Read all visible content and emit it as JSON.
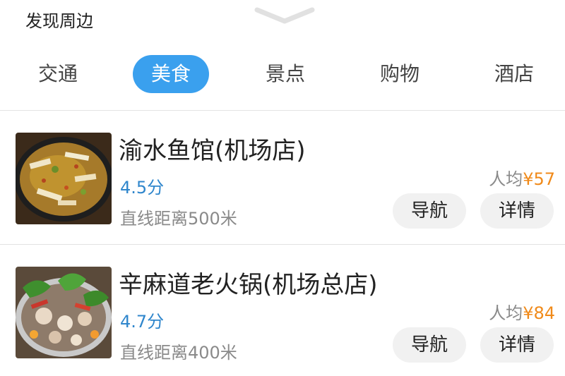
{
  "panel": {
    "title": "发现周边"
  },
  "tabs": [
    {
      "label": "交通",
      "active": false
    },
    {
      "label": "美食",
      "active": true
    },
    {
      "label": "景点",
      "active": false
    },
    {
      "label": "购物",
      "active": false
    },
    {
      "label": "酒店",
      "active": false
    }
  ],
  "restaurants": [
    {
      "name": "渝水鱼馆(机场店)",
      "rating": "4.5分",
      "distance": "直线距离500米",
      "price_label": "人均",
      "price_amount": "¥57",
      "nav_label": "导航",
      "detail_label": "详情"
    },
    {
      "name": "辛麻道老火锅(机场总店)",
      "rating": "4.7分",
      "distance": "直线距离400米",
      "price_label": "人均",
      "price_amount": "¥84",
      "nav_label": "导航",
      "detail_label": "详情"
    }
  ],
  "colors": {
    "accent": "#3aa0ee",
    "rating": "#2f86cc",
    "price": "#f08a1a"
  }
}
